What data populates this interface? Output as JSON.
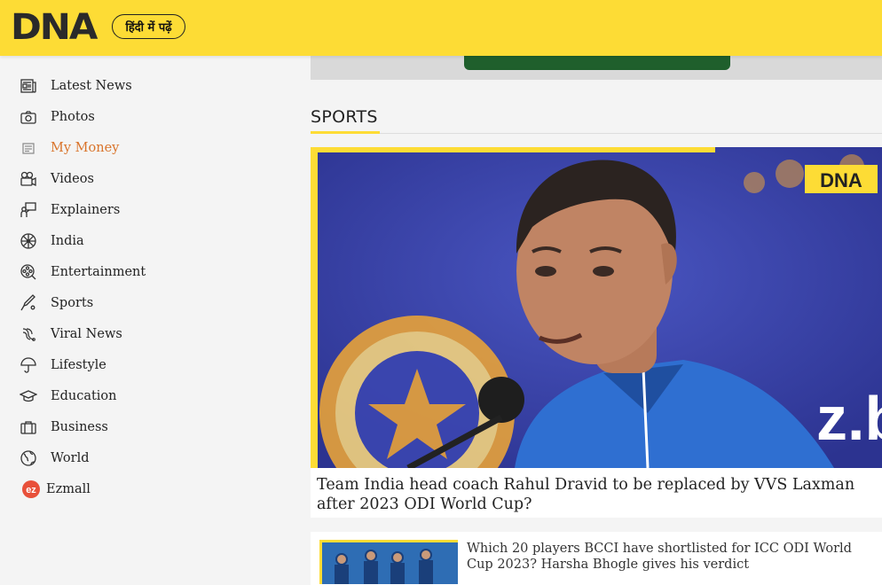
{
  "header": {
    "logo_text": "DNA",
    "hindi_button": "हिंदी में पढ़ें",
    "brand_color": "#fddc35"
  },
  "sidebar": {
    "items": [
      {
        "label": "Latest News",
        "icon": "newspaper-icon"
      },
      {
        "label": "Photos",
        "icon": "camera-icon"
      },
      {
        "label": "My Money",
        "icon": "money-icon",
        "active": true
      },
      {
        "label": "Videos",
        "icon": "video-camera-icon"
      },
      {
        "label": "Explainers",
        "icon": "presenter-icon"
      },
      {
        "label": "India",
        "icon": "ashoka-chakra-icon"
      },
      {
        "label": "Entertainment",
        "icon": "film-reel-icon"
      },
      {
        "label": "Sports",
        "icon": "cricket-bat-icon"
      },
      {
        "label": "Viral News",
        "icon": "viral-icon"
      },
      {
        "label": "Lifestyle",
        "icon": "umbrella-icon"
      },
      {
        "label": "Education",
        "icon": "graduation-cap-icon"
      },
      {
        "label": "Business",
        "icon": "briefcase-icon"
      },
      {
        "label": "World",
        "icon": "globe-icon"
      },
      {
        "label": "Ezmall",
        "icon": "ezmall-logo-icon"
      }
    ],
    "active_color": "#d9742b"
  },
  "main": {
    "section_title": "SPORTS",
    "hero": {
      "title": "Team India head coach Rahul Dravid to be replaced by VVS Laxman after 2023 ODI World Cup?",
      "badge": "DNA",
      "backdrop_text": "z.bo"
    },
    "story2": {
      "title": "Which 20 players BCCI have shortlisted for ICC ODI World Cup 2023? Harsha Bhogle gives his verdict"
    }
  }
}
